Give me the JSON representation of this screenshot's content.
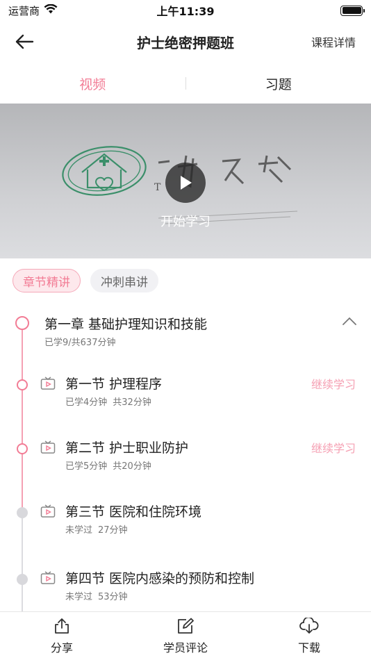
{
  "status_bar": {
    "carrier": "运营商",
    "time": "上午11:39"
  },
  "nav": {
    "title": "护士绝密押题班",
    "detail_label": "课程详情"
  },
  "tabs": [
    {
      "label": "视频",
      "active": true
    },
    {
      "label": "习题",
      "active": false
    }
  ],
  "video": {
    "play_label": "开始学习",
    "watermark_text": "一 护之家"
  },
  "chips": [
    {
      "label": "章节精讲",
      "active": true
    },
    {
      "label": "冲刺串讲",
      "active": false
    }
  ],
  "chapter": {
    "title": "第一章 基础护理知识和技能",
    "progress": "已学9/共637分钟"
  },
  "sections": [
    {
      "title": "第一节 护理程序",
      "learned": "已学4分钟",
      "total": "共32分钟",
      "action": "继续学习",
      "started": true
    },
    {
      "title": "第二节  护士职业防护",
      "learned": "已学5分钟",
      "total": "共20分钟",
      "action": "继续学习",
      "started": true
    },
    {
      "title": "第三节 医院和住院环境",
      "learned": "未学过",
      "total": "27分钟",
      "action": "",
      "started": false
    },
    {
      "title": "第四节 医院内感染的预防和控制",
      "learned": "未学过",
      "total": "53分钟",
      "action": "",
      "started": false
    }
  ],
  "bottom_bar": {
    "share_label": "分享",
    "review_label": "学员评论",
    "download_label": "下载"
  },
  "colors": {
    "accent": "#f27c95",
    "accent_light": "#fde8ec",
    "muted_dot": "#d8d8dc"
  },
  "icons": [
    "wifi-icon",
    "battery-icon",
    "back-arrow-icon",
    "play-icon",
    "chevron-up-icon",
    "video-icon",
    "share-icon",
    "edit-icon",
    "cloud-download-icon"
  ]
}
